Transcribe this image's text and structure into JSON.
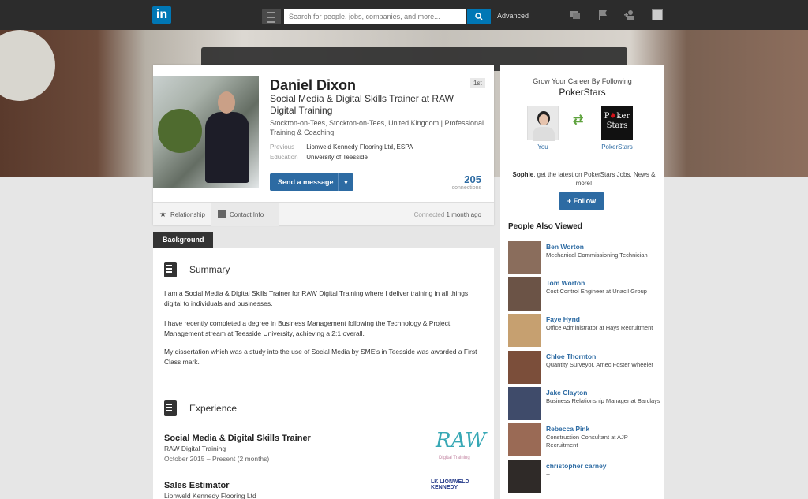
{
  "nav": {
    "logo": "in",
    "search_placeholder": "Search for people, jobs, companies, and more...",
    "advanced": "Advanced"
  },
  "profile": {
    "name": "Daniel Dixon",
    "degree": "1st",
    "headline": "Social Media & Digital Skills Trainer at RAW Digital Training",
    "location": "Stockton-on-Tees, Stockton-on-Tees, United Kingdom  |  Professional Training & Coaching",
    "previous_label": "Previous",
    "previous_value": "Lionweld Kennedy Flooring Ltd, ESPA",
    "education_label": "Education",
    "education_value": "University of Teesside",
    "send_message": "Send a message",
    "connections_count": "205",
    "connections_label": "connections",
    "relationship_tab": "Relationship",
    "contact_tab": "Contact Info",
    "connected_prefix": "Connected",
    "connected_time": "1 month ago"
  },
  "background": {
    "tab_label": "Background",
    "summary_title": "Summary",
    "summary_paragraphs": [
      "I am a Social Media & Digital Skills Trainer for RAW Digital Training where I deliver training in all things digital to individuals and businesses.",
      "I have recently completed a degree in Business Management following the Technology & Project Management stream at Teesside University, achieving a 2:1 overall.",
      "My dissertation which was a study into the use of Social Media by SME's in Teesside was awarded a First Class mark."
    ],
    "experience_title": "Experience",
    "jobs": [
      {
        "title": "Social Media & Digital Skills Trainer",
        "company": "RAW Digital Training",
        "dates": "October 2015 – Present (2 months)"
      },
      {
        "title": "Sales Estimator",
        "company": "Lionweld Kennedy Flooring Ltd"
      }
    ],
    "raw_logo": "RAW",
    "raw_logo_sub": "Digital Training",
    "lk_logo": "LK LIONWELD KENNEDY"
  },
  "sidebar": {
    "promo_title": "Grow Your Career By Following",
    "promo_company": "PokerStars",
    "you_label": "You",
    "company_label": "PokerStars",
    "promo_name": "Sophie",
    "promo_message": ", get the latest on PokerStars Jobs, News & more!",
    "follow_label": "+ Follow",
    "pav_title": "People Also Viewed",
    "people": [
      {
        "name": "Ben Worton",
        "title": "Mechanical Commissioning Technician",
        "color": "#8a6d5c"
      },
      {
        "name": "Tom Worton",
        "title": "Cost Control Engineer at Unacil Group",
        "color": "#6b5346"
      },
      {
        "name": "Faye Hynd",
        "title": "Office Administrator at Hays Recruitment",
        "color": "#c6a070"
      },
      {
        "name": "Chloe Thornton",
        "title": "Quantity Surveyor, Amec Foster Wheeler",
        "color": "#7b4e3a"
      },
      {
        "name": "Jake Clayton",
        "title": "Business Relationship Manager at Barclays",
        "color": "#3f4b6a"
      },
      {
        "name": "Rebecca Pink",
        "title": "Construction Consultant at AJP Recruitment",
        "color": "#9a6a55"
      },
      {
        "name": "christopher carney",
        "title": "--",
        "color": "#2f2a28"
      }
    ]
  }
}
